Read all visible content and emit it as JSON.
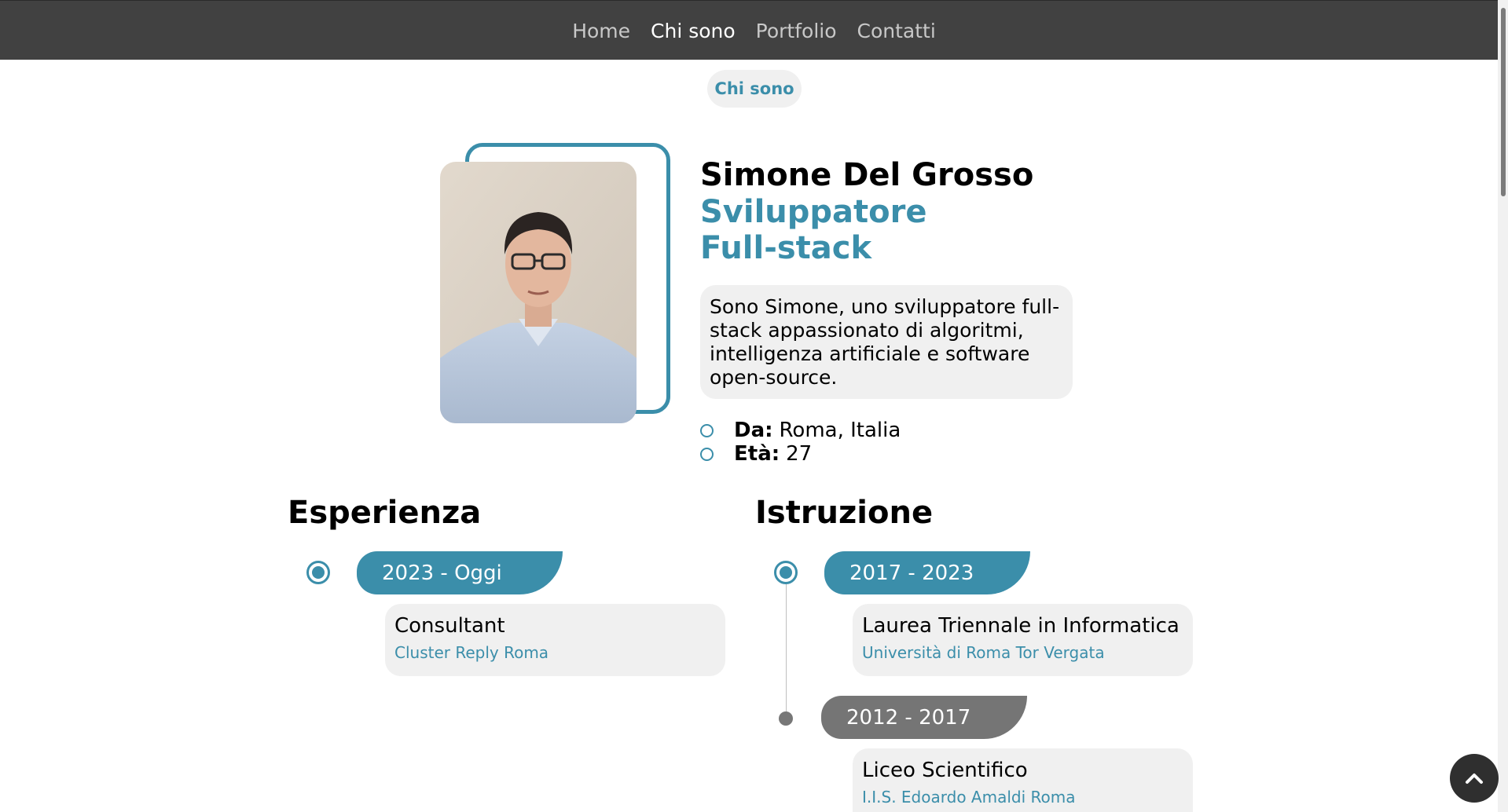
{
  "nav": {
    "items": [
      {
        "label": "Home",
        "active": false
      },
      {
        "label": "Chi sono",
        "active": true
      },
      {
        "label": "Portfolio",
        "active": false
      },
      {
        "label": "Contatti",
        "active": false
      }
    ]
  },
  "section": {
    "badge": "Chi sono"
  },
  "profile": {
    "name": "Simone Del Grosso",
    "role_line1": "Sviluppatore",
    "role_line2": "Full-stack",
    "bio": "Sono Simone, uno sviluppatore full-stack appassionato di algoritmi, intelligenza artificiale e software open-source.",
    "info": [
      {
        "label": "Da:",
        "value": "Roma, Italia"
      },
      {
        "label": "Età:",
        "value": "27"
      }
    ]
  },
  "experience": {
    "heading": "Esperienza",
    "items": [
      {
        "date": "2023 - Oggi",
        "title": "Consultant",
        "subtitle": "Cluster Reply Roma"
      }
    ]
  },
  "education": {
    "heading": "Istruzione",
    "items": [
      {
        "date": "2017 - 2023",
        "title": "Laurea Triennale in Informatica",
        "subtitle": "Università di Roma Tor Vergata"
      },
      {
        "date": "2012 - 2017",
        "title": "Liceo Scientifico",
        "subtitle": "I.I.S. Edoardo Amaldi Roma"
      }
    ]
  },
  "colors": {
    "accent": "#3b8eaa",
    "navbar": "#414141",
    "card": "#f0f0f0",
    "past": "#757575"
  },
  "icons": {
    "back_to_top": "chevron-up-icon"
  }
}
